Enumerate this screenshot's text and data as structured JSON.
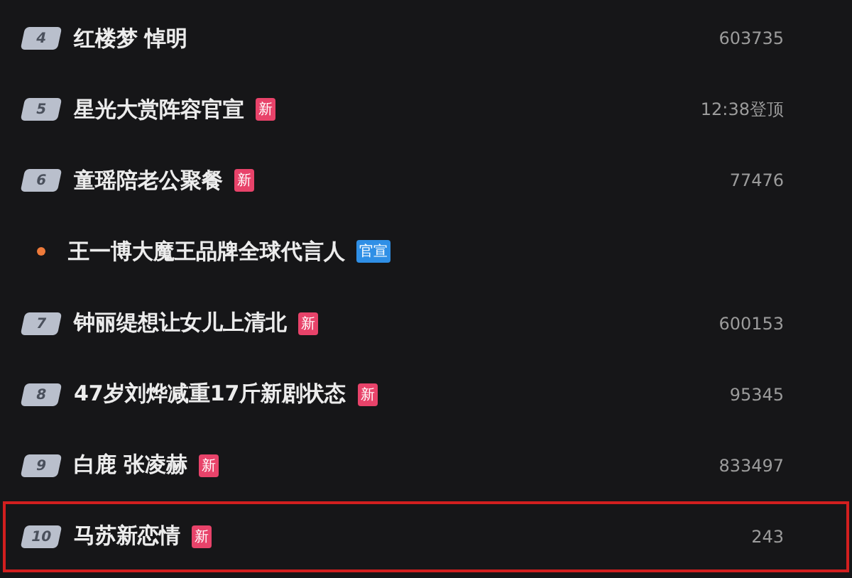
{
  "rows": [
    {
      "kind": "rank",
      "rank": "4",
      "title": "红楼梦 悼明",
      "count": "603735",
      "selected": false
    },
    {
      "kind": "rank",
      "rank": "5",
      "title": "星光大赏阵容官宣",
      "tag": {
        "kind": "new",
        "text": "新"
      },
      "count": "12:38登顶",
      "selected": false
    },
    {
      "kind": "rank",
      "rank": "6",
      "title": "童瑶陪老公聚餐",
      "tag": {
        "kind": "new",
        "text": "新"
      },
      "count": "77476",
      "selected": false
    },
    {
      "kind": "dot",
      "title": "王一博大魔王品牌全球代言人",
      "tag": {
        "kind": "official",
        "text": "官宣"
      },
      "selected": false
    },
    {
      "kind": "rank",
      "rank": "7",
      "title": "钟丽缇想让女儿上清北",
      "tag": {
        "kind": "new",
        "text": "新"
      },
      "count": "600153",
      "selected": false
    },
    {
      "kind": "rank",
      "rank": "8",
      "title": "47岁刘烨减重17斤新剧状态",
      "tag": {
        "kind": "new",
        "text": "新"
      },
      "count": "95345",
      "selected": false
    },
    {
      "kind": "rank",
      "rank": "9",
      "title": "白鹿 张凌赫",
      "tag": {
        "kind": "new",
        "text": "新"
      },
      "count": "833497",
      "selected": false
    },
    {
      "kind": "rank",
      "rank": "10",
      "title": "马苏新恋情",
      "tag": {
        "kind": "new",
        "text": "新"
      },
      "count": "243",
      "selected": true
    }
  ]
}
